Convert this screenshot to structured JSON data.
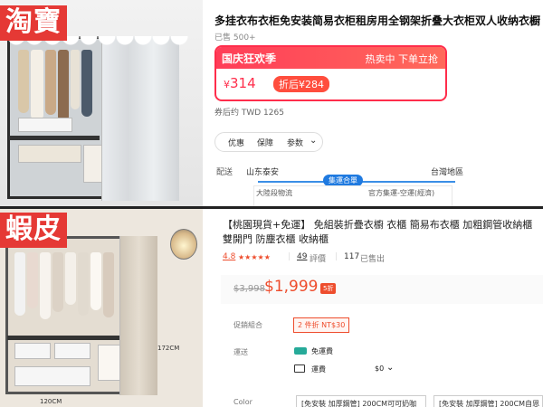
{
  "taobao": {
    "platform_label": "淘寶",
    "title": "多挂衣布衣柜免安装简易衣柜租房用全钢架折叠大衣柜双人收纳衣橱",
    "sold": "已售 500+",
    "promo_name": "国庆狂欢季",
    "promo_status": "热卖中  下单立抢",
    "price_currency": "¥",
    "price": "314",
    "discount_badge": "折后¥284",
    "coupon_price": "券后约 TWD 1265",
    "tabs": [
      "优惠",
      "保障",
      "参数"
    ],
    "shipping": {
      "label": "配送",
      "origin": "山东泰安",
      "destination": "台灣地區",
      "route": "集運合單",
      "leg1": "大陸段物流",
      "leg2": "官方集運-空運(經濟)"
    }
  },
  "shopee": {
    "platform_label": "蝦皮",
    "title": "【桃園現貨+免運】 免組裝折疊衣櫥 衣櫃 簡易布衣櫃 加粗鋼管收納櫃 雙開門 防塵衣櫃 收納櫃",
    "rating": "4.8",
    "stars": "★★★★★",
    "reviews_count": "49",
    "reviews_label": "評價",
    "sold_count": "117",
    "sold_label": "已售出",
    "original_price": "$3,998",
    "price": "$1,999",
    "discount": "5折",
    "combo_label": "促銷組合",
    "combo_value": "2 件折 NT$30",
    "ship_label": "運送",
    "free_ship": "免運費",
    "ship_fee_label": "運費",
    "ship_fee": "$0",
    "color_label": "Color",
    "options": [
      "[免安裝 加厚鋼管] 200CM可可奶咖",
      "[免安裝 加厚鋼管] 200CM自恩"
    ],
    "dim_height": "172CM",
    "dim_width": "120CM"
  },
  "colors": {
    "tag_red": "#e53935",
    "taobao_accent": "#ff2d4b",
    "shopee_accent": "#ee4d2d"
  }
}
